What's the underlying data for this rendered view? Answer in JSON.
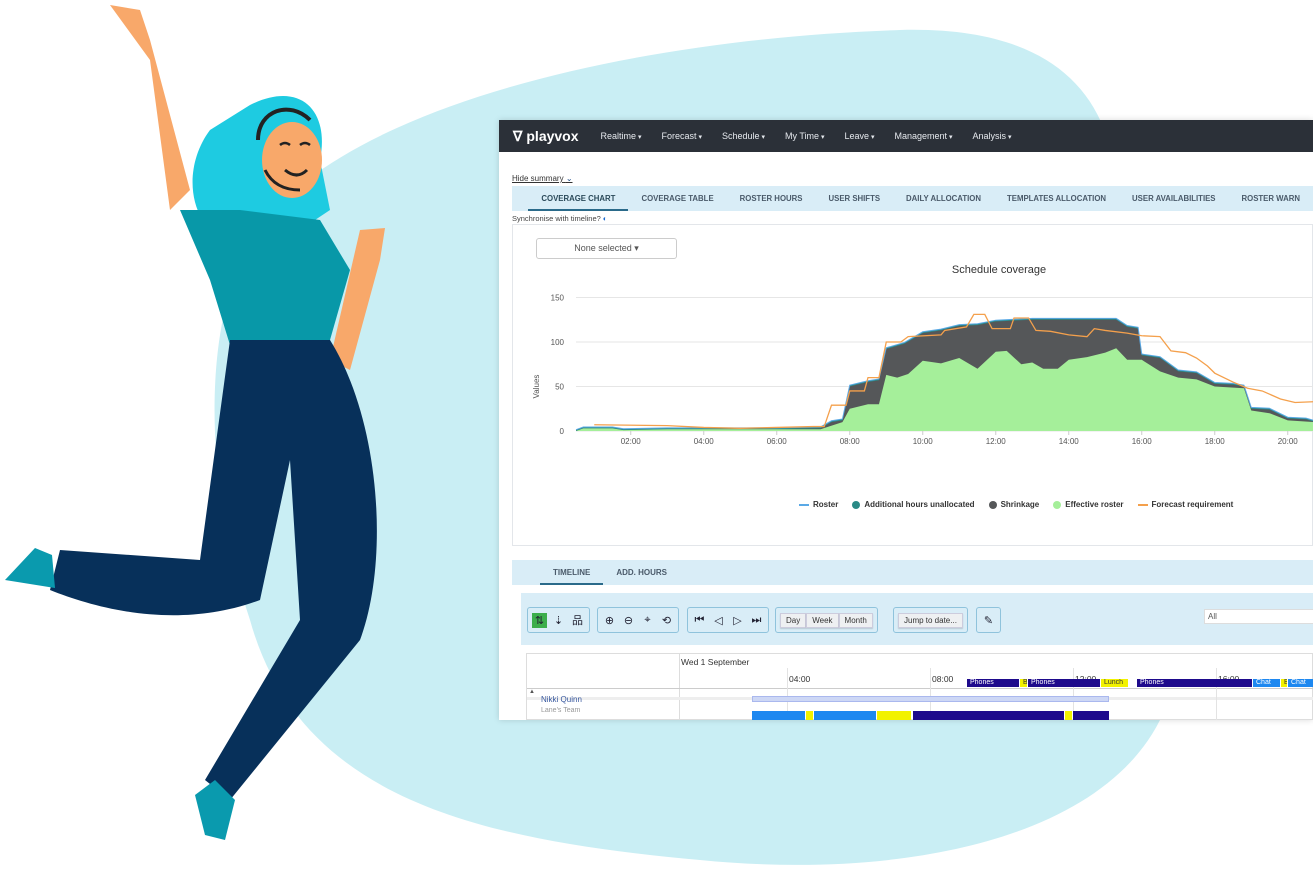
{
  "nav": {
    "brand": "playvox",
    "items": [
      "Realtime",
      "Forecast",
      "Schedule",
      "My Time",
      "Leave",
      "Management",
      "Analysis"
    ]
  },
  "summary_toggle": "Hide summary",
  "tabs": [
    "COVERAGE CHART",
    "COVERAGE TABLE",
    "ROSTER HOURS",
    "USER SHIFTS",
    "DAILY ALLOCATION",
    "TEMPLATES ALLOCATION",
    "USER AVAILABILITIES",
    "ROSTER WARN"
  ],
  "sync_label": "Synchronise with timeline?",
  "filter_select": "None selected",
  "bottom_tabs": [
    "TIMELINE",
    "ADD. HOURS"
  ],
  "toolbar": {
    "views": [
      "Day",
      "Week",
      "Month"
    ],
    "jump": "Jump to date...",
    "filter_value": "All"
  },
  "timeline": {
    "date": "Wed 1 September",
    "hours": [
      "04:00",
      "08:00",
      "12:00",
      "16:00"
    ],
    "user": "Nikki Quinn",
    "team": "Lane's Team",
    "activities": [
      "Phones",
      "B",
      "Phones",
      "Lunch",
      "Phones",
      "Chat",
      "B",
      "Chat"
    ]
  },
  "colors": {
    "nav": "#2b3038",
    "tab_bg": "#d9edf7",
    "roster": "#5aa9e6",
    "additional": "#2a8a86",
    "shrinkage": "#555759",
    "effective": "#a5ef9a",
    "forecast": "#f4a04c",
    "phones": "#1e0a8c",
    "break": "#f2f200",
    "chat": "#1e88f0"
  },
  "chart_data": {
    "type": "area",
    "title": "Schedule coverage",
    "ylabel": "Values",
    "xlabel": "",
    "ylim": [
      0,
      200
    ],
    "yticks": [
      0,
      50,
      100,
      150,
      200
    ],
    "xticks": [
      "02:00",
      "04:00",
      "06:00",
      "08:00",
      "10:00",
      "12:00",
      "14:00",
      "16:00",
      "18:00",
      "20:00"
    ],
    "xlim_hours": [
      0.5,
      20.75
    ],
    "grid": true,
    "legend": "bottom",
    "x_hours_roster": [
      0.5,
      0.7,
      1.5,
      1.8,
      3,
      5,
      6,
      7.2,
      7.5,
      7.8,
      8,
      8.5,
      8.8,
      9,
      9.5,
      10,
      10.5,
      11,
      11.5,
      12,
      13,
      14,
      15,
      15.3,
      15.6,
      15.9,
      16,
      16.5,
      17,
      17.5,
      18,
      18.5,
      18.8,
      19,
      19.5,
      20,
      20.5,
      20.75
    ],
    "roster": [
      0,
      3,
      3,
      1,
      2,
      2,
      2,
      3,
      10,
      12,
      50,
      55,
      57,
      92,
      98,
      110,
      113,
      118,
      119,
      123,
      125,
      125,
      125,
      125,
      117,
      115,
      85,
      82,
      67,
      65,
      53,
      52,
      50,
      25,
      24,
      14,
      13,
      10
    ],
    "x_hours_effective": [
      0.5,
      0.7,
      1.5,
      1.8,
      3,
      5,
      7.2,
      7.8,
      8,
      8.5,
      8.8,
      9,
      9.3,
      9.6,
      10,
      10.5,
      11,
      11.5,
      12,
      12.3,
      12.7,
      13,
      13.3,
      13.7,
      14,
      14.5,
      15,
      15.3,
      15.6,
      16,
      16.5,
      17,
      17.5,
      18,
      18.8,
      19,
      19.5,
      20,
      20.75
    ],
    "effective_roster": [
      0,
      3,
      3,
      1,
      2,
      2,
      2,
      10,
      25,
      30,
      30,
      63,
      60,
      64,
      79,
      76,
      82,
      70,
      89,
      90,
      75,
      77,
      70,
      70,
      80,
      83,
      88,
      93,
      80,
      80,
      67,
      60,
      58,
      50,
      48,
      23,
      20,
      12,
      10
    ],
    "x_hours_forecast": [
      1,
      3,
      4,
      5,
      6,
      7,
      7.3,
      7.5,
      7.9,
      8,
      8.4,
      8.5,
      8.8,
      9,
      9.4,
      9.6,
      10.5,
      10.6,
      11.2,
      11.4,
      11.7,
      11.9,
      12.4,
      12.5,
      12.9,
      13.1,
      13.5,
      14,
      14.5,
      14.7,
      15,
      15.6,
      16,
      16.5,
      16.8,
      17.2,
      17.5,
      17.8,
      18,
      18.5,
      18.9,
      19.3,
      19.8,
      20.2,
      20.75
    ],
    "forecast_requirement": [
      7,
      6,
      4,
      3,
      4,
      5,
      5,
      29,
      29,
      45,
      45,
      60,
      60,
      100,
      100,
      106,
      108,
      113,
      117,
      131,
      131,
      115,
      115,
      127,
      127,
      113,
      112,
      108,
      106,
      115,
      113,
      110,
      107,
      106,
      90,
      88,
      82,
      73,
      65,
      55,
      48,
      45,
      36,
      32,
      33
    ],
    "series_names": [
      "Roster",
      "Additional hours unallocated",
      "Shrinkage",
      "Effective roster",
      "Forecast requirement"
    ]
  }
}
